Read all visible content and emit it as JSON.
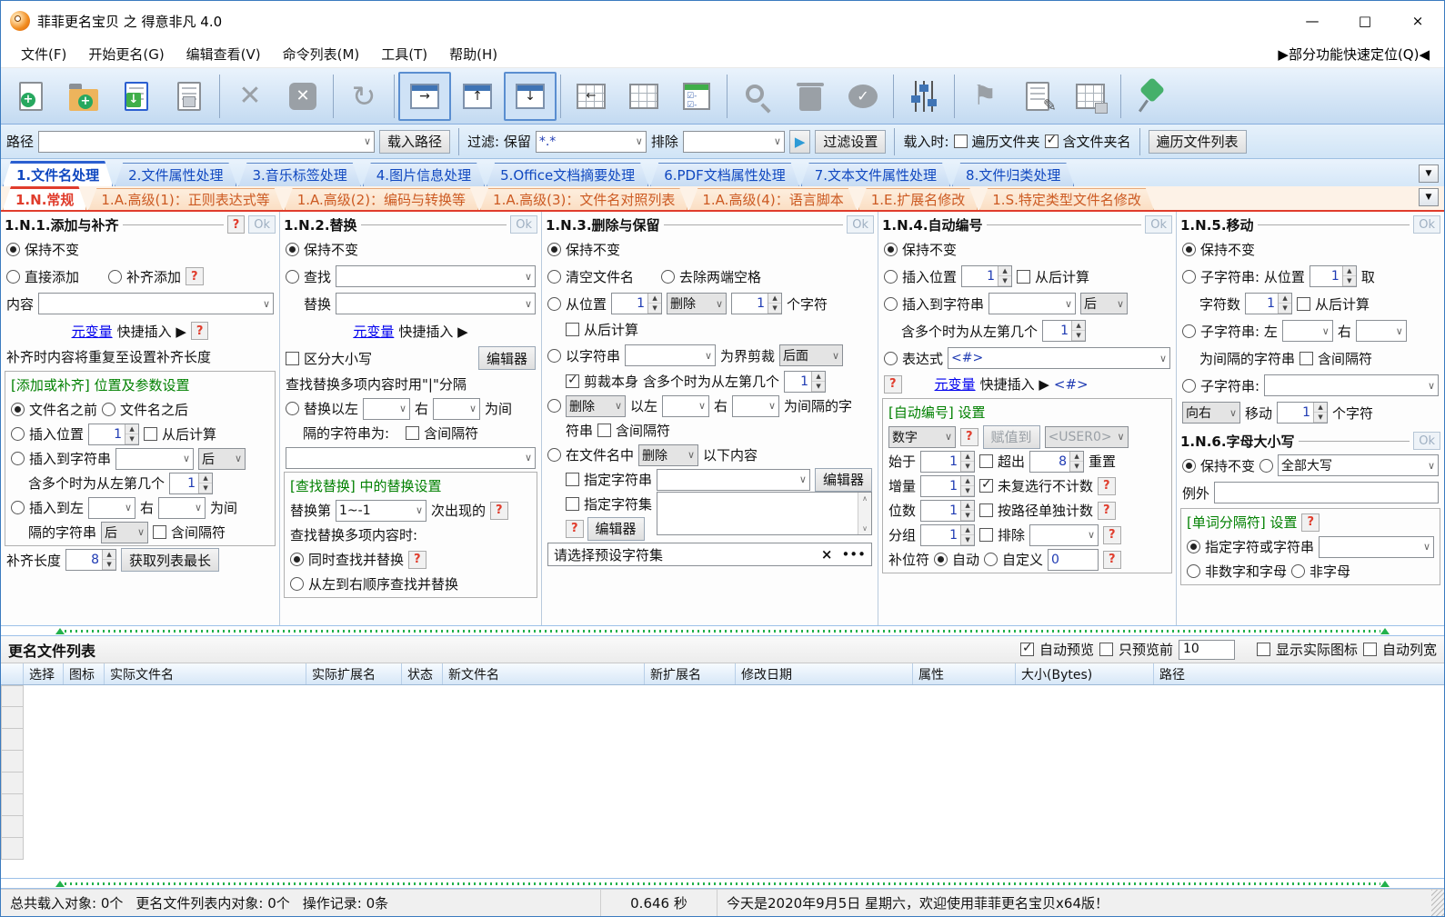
{
  "colors": {
    "accent_blue": "#2b5fd0",
    "accent_red": "#e03c2c",
    "group_green": "#008000",
    "link_blue": "#0000ee",
    "pin_green": "#45b06b"
  },
  "chrome": {
    "title": "菲菲更名宝贝 之 得意非凡 4.0",
    "min": "—",
    "max": "□",
    "close": "×"
  },
  "menu": {
    "items": [
      "文件(F)",
      "开始更名(G)",
      "编辑查看(V)",
      "命令列表(M)",
      "工具(T)",
      "帮助(H)"
    ],
    "quick": "▶部分功能快速定位(Q)◀"
  },
  "pathbar": {
    "path_label": "路径",
    "load_path": "载入路径",
    "filter_label": "过滤: 保留",
    "filter_value": "*.*",
    "exclude_label": "排除",
    "play": "▶",
    "filter_settings": "过滤设置",
    "load_when": "载入时:",
    "traverse_folders": "遍历文件夹",
    "include_folder": "含文件夹名",
    "traverse_list": "遍历文件列表"
  },
  "tabs1": {
    "items": [
      "1.文件名处理",
      "2.文件属性处理",
      "3.音乐标签处理",
      "4.图片信息处理",
      "5.Office文档摘要处理",
      "6.PDF文档属性处理",
      "7.文本文件属性处理",
      "8.文件归类处理"
    ],
    "drop": "▼"
  },
  "tabs2": {
    "items": [
      "1.N.常规",
      "1.A.高级(1)：正则表达式等",
      "1.A.高级(2)：编码与转换等",
      "1.A.高级(3)：文件名对照列表",
      "1.A.高级(4)：语言脚本",
      "1.E.扩展名修改",
      "1.S.特定类型文件名修改"
    ],
    "drop": "▼"
  },
  "shared": {
    "ok": "Ok",
    "help": "?",
    "keep": "保持不变",
    "meta": "元变量",
    "quick_insert": "快捷插入 ▶",
    "editor": "编辑器",
    "incl_sep": "含间隔符",
    "from_end": "从后计算",
    "right": "右",
    "nth_note": "含多个时为从左第几个",
    "after": "后"
  },
  "p1": {
    "title": "1.N.1.添加与补齐",
    "direct": "直接添加",
    "pad": "补齐添加",
    "content": "内容",
    "note": "补齐时内容将重复至设置补齐长度",
    "group": "[添加或补齐] 位置及参数设置",
    "before_name": "文件名之前",
    "after_name": "文件名之后",
    "ins_pos": "插入位置",
    "pos_val": "1",
    "ins_str": "插入到字符串",
    "nth_val": "1",
    "ins_left": "插入到左",
    "as_sep": "为间",
    "sep_str": "隔的字符串",
    "pad_len": "补齐长度",
    "pad_val": "8",
    "get_longest": "获取列表最长"
  },
  "p2": {
    "title": "1.N.2.替换",
    "find": "查找",
    "repl": "替换",
    "case_sens": "区分大小写",
    "note": "查找替换多项内容时用\"|\"分隔",
    "repl_left": "替换以左",
    "as_sep": "为间",
    "sep_line": "隔的字符串为:",
    "group": "[查找替换] 中的替换设置",
    "nth_label": "替换第",
    "nth_val": "1~-1",
    "occur": "次出现的",
    "multi": "查找替换多项内容时:",
    "simul": "同时查找并替换",
    "seq": "从左到右顺序查找并替换"
  },
  "p3": {
    "title": "1.N.3.删除与保留",
    "clear": "清空文件名",
    "trim": "去除两端空格",
    "from_pos": "从位置",
    "pos_val": "1",
    "del": "删除",
    "cnt_val": "1",
    "chars": "个字符",
    "by_str": "以字符串",
    "bound": "为界剪裁",
    "back": "后面",
    "crop_self": "剪裁本身",
    "nth_val": "1",
    "left": "以左",
    "as_sep2": "为间隔的字",
    "str2": "符串",
    "in_name": "在文件名中",
    "following": "以下内容",
    "spec_str": "指定字符串",
    "spec_set": "指定字符集",
    "preset": "请选择预设字符集",
    "clear_x": "×",
    "more": "•••"
  },
  "p4": {
    "title": "1.N.4.自动编号",
    "ins_pos": "插入位置",
    "pos_val": "1",
    "ins_str": "插入到字符串",
    "nth_val": "1",
    "expr": "表达式",
    "expr_val": "<#>",
    "expr_tag": "<#>",
    "group": "[自动编号] 设置",
    "num": "数字",
    "assign": "赋值到",
    "user": "<USER0>",
    "start": "始于",
    "start_val": "1",
    "exceed": "超出",
    "exceed_val": "8",
    "reset": "重置",
    "inc": "增量",
    "inc_val": "1",
    "skip": "未复选行不计数",
    "digits": "位数",
    "dig_val": "1",
    "per_path": "按路径单独计数",
    "grp": "分组",
    "grp_val": "1",
    "excl": "排除",
    "pad_char": "补位符",
    "auto": "自动",
    "custom": "自定义",
    "custom_val": "0"
  },
  "p5": {
    "title": "1.N.5.移动",
    "sub_pos": "子字符串: 从位置",
    "pos_val": "1",
    "take": "取",
    "cnt": "字符数",
    "cnt_val": "1",
    "sub_lr": "子字符串: 左",
    "as_sep_str": "为间隔的字符串",
    "sub": "子字符串:",
    "dir": "向右",
    "move": "移动",
    "move_val": "1",
    "chars": "个字符"
  },
  "p6": {
    "title": "1.N.6.字母大小写",
    "upper": "全部大写",
    "except": "例外",
    "group": "[单词分隔符] 设置",
    "spec": "指定字符或字符串",
    "non_alnum": "非数字和字母",
    "non_alpha": "非字母"
  },
  "filelist": {
    "label": "更名文件列表",
    "auto_preview": "自动预览",
    "preview_first": "只预览前",
    "preview_n": "10",
    "show_icons": "显示实际图标",
    "auto_width": "自动列宽",
    "columns": [
      "选择",
      "图标",
      "实际文件名",
      "实际扩展名",
      "状态",
      "新文件名",
      "新扩展名",
      "修改日期",
      "属性",
      "大小(Bytes)",
      "路径"
    ]
  },
  "statusbar": {
    "loaded": "总共载入对象: 0个",
    "in_list": "更名文件列表内对象: 0个",
    "ops": "操作记录: 0条",
    "time": "0.646 秒",
    "greet": "今天是2020年9月5日 星期六，欢迎使用菲菲更名宝贝x64版！"
  }
}
